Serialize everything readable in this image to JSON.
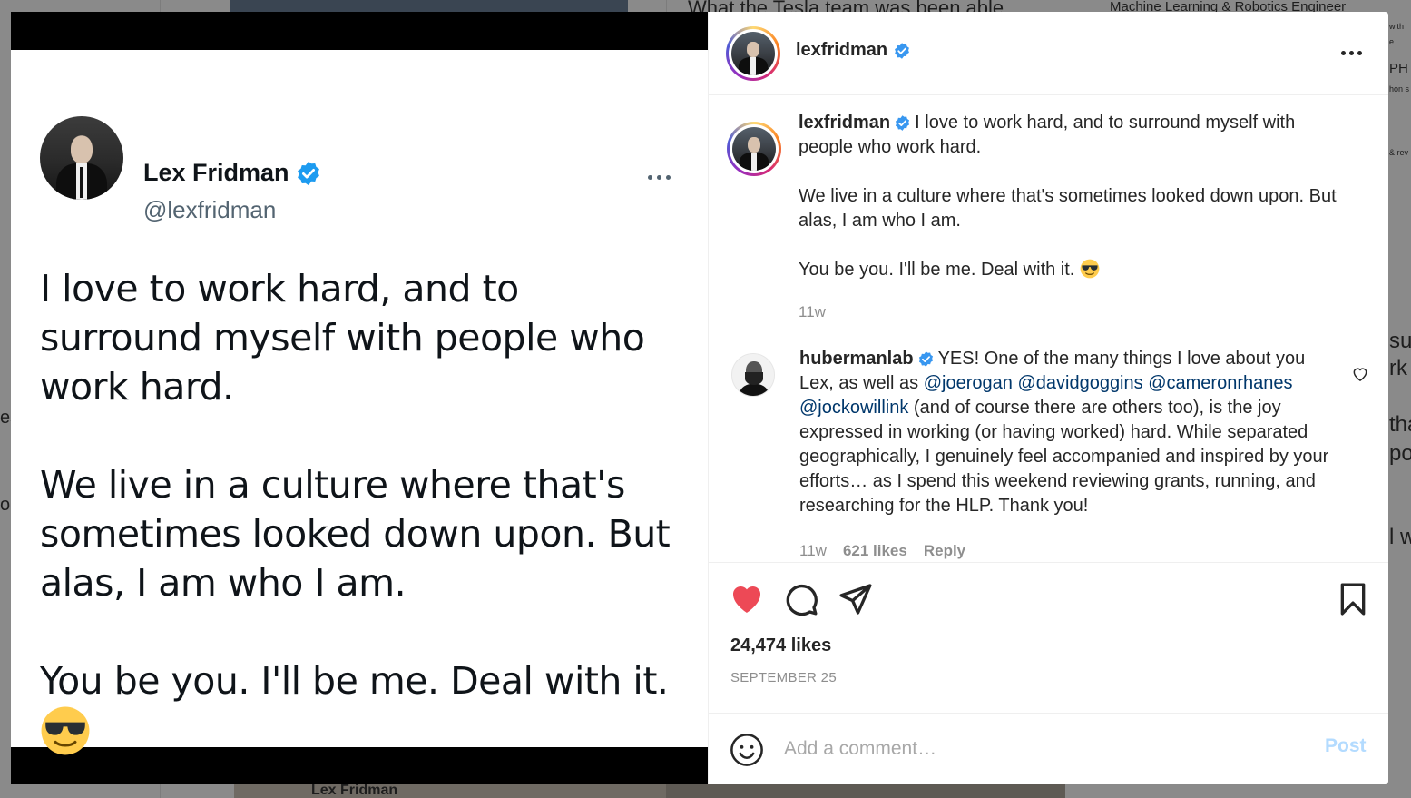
{
  "background": {
    "top_left_heading": "What the Tesla team was been able",
    "top_right_heading": "Machine Learning & Robotics Engineer",
    "bottom_left_name": "Lex Fridman",
    "fragments": [
      "with",
      "e.",
      "PH",
      "hon s",
      "& rev",
      "su",
      "rk",
      "tha",
      "po",
      "l w",
      "es",
      "o"
    ]
  },
  "tweet": {
    "name": "Lex Fridman",
    "handle": "@lexfridman",
    "paragraphs": [
      "I love to work hard, and to surround myself with people who work hard.",
      "We live in a culture where that's sometimes looked down upon. But alas, I am who I am.",
      "You be you. I'll be me. Deal with it."
    ],
    "emoji": "sunglasses-emoji"
  },
  "post": {
    "header": {
      "username": "lexfridman"
    },
    "caption": {
      "username": "lexfridman",
      "line1": "I love to work hard, and to surround myself with people who work hard.",
      "line2": "We live in a culture where that's sometimes looked down upon. But alas, I am who I am.",
      "line3": "You be you. I'll be me. Deal with it.",
      "time": "11w"
    },
    "comment": {
      "username": "hubermanlab",
      "text_start": "YES! One of the many things I love about you Lex, as well as",
      "mentions": [
        "@joerogan",
        "@davidgoggins",
        "@cameronrhanes",
        "@jockowillink"
      ],
      "text_end": "(and of course there are others too), is the joy expressed in working (or having worked) hard. While separated geographically, I genuinely feel accompanied and inspired by your efforts… as I spend this weekend reviewing grants, running, and researching for the HLP. Thank you!",
      "time": "11w",
      "likes": "621 likes",
      "reply": "Reply"
    },
    "likes": "24,474 likes",
    "date": "SEPTEMBER 25",
    "comment_box": {
      "placeholder": "Add a comment…",
      "post_label": "Post"
    },
    "colors": {
      "like_red": "#ed4956",
      "verified_blue": "#3897f0",
      "mention_blue": "#00376b",
      "post_disabled": "#b3dbff"
    }
  }
}
